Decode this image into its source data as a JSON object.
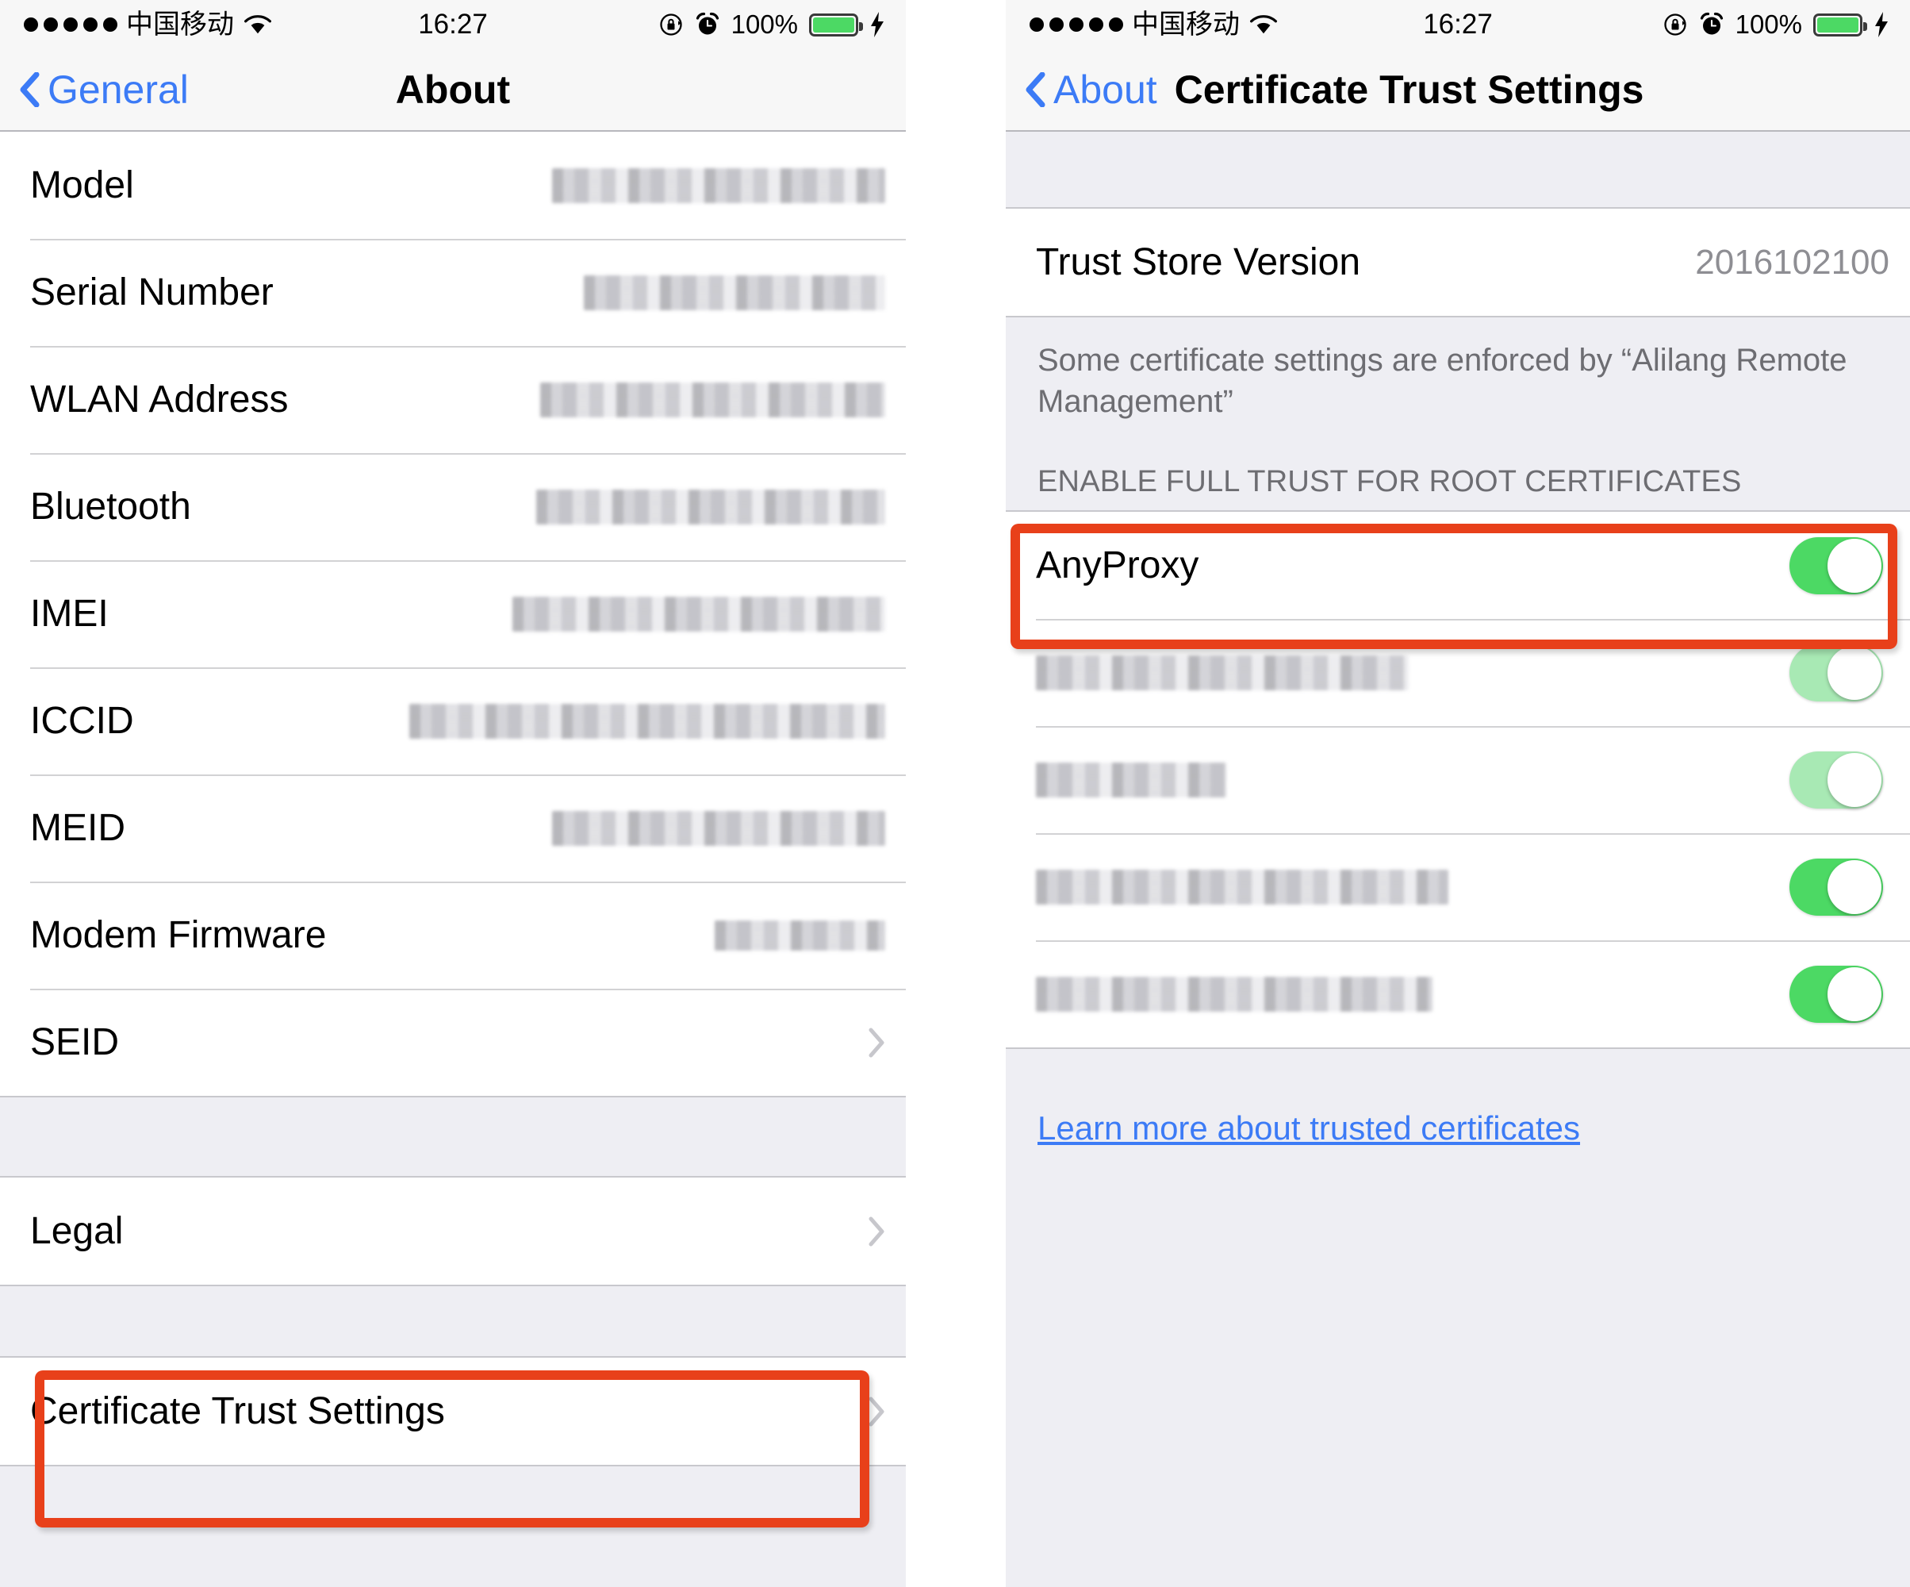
{
  "status_bar": {
    "signal_dots": 5,
    "carrier": "中国移动",
    "wifi_icon": "wifi-icon",
    "time": "16:27",
    "rotation_lock_icon": "rotation-lock-icon",
    "alarm_icon": "alarm-clock-icon",
    "battery_percent": "100%",
    "battery_icon": "battery-icon",
    "charging_icon": "lightning-bolt-icon"
  },
  "colors": {
    "accent_blue": "#3c7bf6",
    "toggle_green": "#4cd964",
    "toggle_green_dim": "#a8e9b4",
    "highlight_red": "#e8401a",
    "group_bg": "#eeeef3",
    "secondary_text": "#8e8e93"
  },
  "left_panel": {
    "nav": {
      "back_label": "General",
      "back_icon": "chevron-left-icon",
      "title": "About"
    },
    "rows": [
      {
        "label": "Model",
        "value": "",
        "redacted": true,
        "accessory": "none",
        "redact_width": 420
      },
      {
        "label": "Serial Number",
        "value": "",
        "redacted": true,
        "accessory": "none",
        "redact_width": 380
      },
      {
        "label": "WLAN Address",
        "value": "",
        "redacted": true,
        "accessory": "none",
        "redact_width": 435
      },
      {
        "label": "Bluetooth",
        "value": "",
        "redacted": true,
        "accessory": "none",
        "redact_width": 440
      },
      {
        "label": "IMEI",
        "value": "",
        "redacted": true,
        "accessory": "none",
        "redact_width": 470
      },
      {
        "label": "ICCID",
        "value": "",
        "redacted": true,
        "accessory": "none",
        "redact_width": 600
      },
      {
        "label": "MEID",
        "value": "",
        "redacted": true,
        "accessory": "none",
        "redact_width": 420
      },
      {
        "label": "Modem Firmware",
        "value": "",
        "redacted": true,
        "accessory": "none",
        "redact_width": 215
      },
      {
        "label": "SEID",
        "value": "",
        "redacted": false,
        "accessory": "chevron",
        "redact_width": 0
      }
    ],
    "legal_row": {
      "label": "Legal",
      "accessory": "chevron"
    },
    "cert_row": {
      "label": "Certificate Trust Settings",
      "accessory": "chevron"
    },
    "highlight": {
      "target": "certificate-trust-settings-row"
    }
  },
  "right_panel": {
    "nav": {
      "back_label": "About",
      "back_icon": "chevron-left-icon",
      "title": "Certificate Trust Settings"
    },
    "trust_store": {
      "label": "Trust Store Version",
      "value": "2016102100"
    },
    "note": "Some certificate settings are enforced by “Alilang Remote Management”",
    "section_header": "ENABLE FULL TRUST FOR ROOT CERTIFICATES",
    "certificates": [
      {
        "name": "AnyProxy",
        "redacted": false,
        "enabled": true,
        "dimmed": false,
        "redact_width": 0,
        "highlighted": true
      },
      {
        "name": "",
        "redacted": true,
        "enabled": true,
        "dimmed": true,
        "redact_width": 470,
        "highlighted": false
      },
      {
        "name": "",
        "redacted": true,
        "enabled": true,
        "dimmed": true,
        "redact_width": 240,
        "highlighted": false
      },
      {
        "name": "",
        "redacted": true,
        "enabled": true,
        "dimmed": false,
        "redact_width": 520,
        "highlighted": false
      },
      {
        "name": "",
        "redacted": true,
        "enabled": true,
        "dimmed": false,
        "redact_width": 500,
        "highlighted": false
      }
    ],
    "learn_more_link": "Learn more about trusted certificates"
  }
}
